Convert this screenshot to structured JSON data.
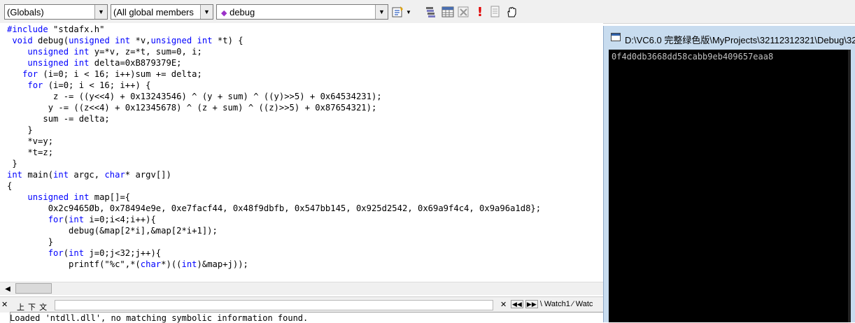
{
  "wizard_bar": {
    "scope_combo": "(Globals)",
    "filter_combo": "(All global members",
    "function_combo": "debug"
  },
  "editor": {
    "lines": [
      [
        {
          "t": "#include",
          "k": true
        },
        {
          "t": " \"stdafx.h\""
        }
      ],
      [
        {
          "t": " "
        },
        {
          "t": "void",
          "k": true
        },
        {
          "t": " debug("
        },
        {
          "t": "unsigned int",
          "k": true
        },
        {
          "t": " *v,"
        },
        {
          "t": "unsigned int",
          "k": true
        },
        {
          "t": " *t) {"
        }
      ],
      [
        {
          "t": "    "
        },
        {
          "t": "unsigned int",
          "k": true
        },
        {
          "t": " y=*v, z=*t, sum=0, i;"
        }
      ],
      [
        {
          "t": "    "
        },
        {
          "t": "unsigned int",
          "k": true
        },
        {
          "t": " delta=0xB879379E;"
        }
      ],
      [
        {
          "t": "   "
        },
        {
          "t": "for",
          "k": true
        },
        {
          "t": " (i=0; i < 16; i++)sum += delta;"
        }
      ],
      [
        {
          "t": "    "
        },
        {
          "t": "for",
          "k": true
        },
        {
          "t": " (i=0; i < 16; i++) {"
        }
      ],
      [
        {
          "t": "         z -= ((y<<4) + 0x13243546) ^ (y + sum) ^ ((y)>>5) + 0x64534231);"
        }
      ],
      [
        {
          "t": "        y -= ((z<<4) + 0x12345678) ^ (z + sum) ^ ((z)>>5) + 0x87654321);"
        }
      ],
      [
        {
          "t": "       sum -= delta;"
        }
      ],
      [
        {
          "t": "    }"
        }
      ],
      [
        {
          "t": "    *v=y;"
        }
      ],
      [
        {
          "t": "    *t=z;"
        }
      ],
      [
        {
          "t": " }"
        }
      ],
      [
        {
          "t": "int",
          "k": true
        },
        {
          "t": " main("
        },
        {
          "t": "int",
          "k": true
        },
        {
          "t": " argc, "
        },
        {
          "t": "char",
          "k": true
        },
        {
          "t": "* argv[])"
        }
      ],
      [
        {
          "t": "{"
        }
      ],
      [
        {
          "t": "    "
        },
        {
          "t": "unsigned int",
          "k": true
        },
        {
          "t": " map[]={"
        }
      ],
      [
        {
          "t": "        0x2c9465Øb, 0x78494e9e, 0xe7facf44, 0x48f9dbfb, 0x547bb145, 0x925d2542, 0x69a9f4c4, 0x9a96a1d8};"
        }
      ],
      [
        {
          "t": "        "
        },
        {
          "t": "for",
          "k": true
        },
        {
          "t": "("
        },
        {
          "t": "int",
          "k": true
        },
        {
          "t": " i=0;i<4;i++){"
        }
      ],
      [
        {
          "t": "            debug(&map[2*i],&map[2*i+1]);"
        }
      ],
      [
        {
          "t": "        }"
        }
      ],
      [
        {
          "t": "        "
        },
        {
          "t": "for",
          "k": true
        },
        {
          "t": "("
        },
        {
          "t": "int",
          "k": true
        },
        {
          "t": " j=0;j<32;j++){"
        }
      ],
      [
        {
          "t": "            printf(\"%c\",*("
        },
        {
          "t": "char",
          "k": true
        },
        {
          "t": "*)(("
        },
        {
          "t": "int",
          "k": true
        },
        {
          "t": ")&map+j));"
        }
      ]
    ]
  },
  "bottom_pane": {
    "tabs_text": "上 下 文",
    "watch_tabs": "\\ Watch1 ⁄ Watc",
    "output_line": "Loaded 'ntdll.dll', no matching symbolic information found."
  },
  "console": {
    "title": "D:\\VC6.0 完整绿色版\\MyProjects\\32112312321\\Debug\\32",
    "output": "0f4d0db3668dd58cabb9eb409657eaa8"
  },
  "icons": {
    "function_icon": "purple-diamond-icon",
    "toolbar": [
      "wizard-action-icon",
      "stack-icon",
      "grid-icon",
      "delete-icon",
      "exclamation-icon",
      "document-icon",
      "hand-icon"
    ]
  }
}
